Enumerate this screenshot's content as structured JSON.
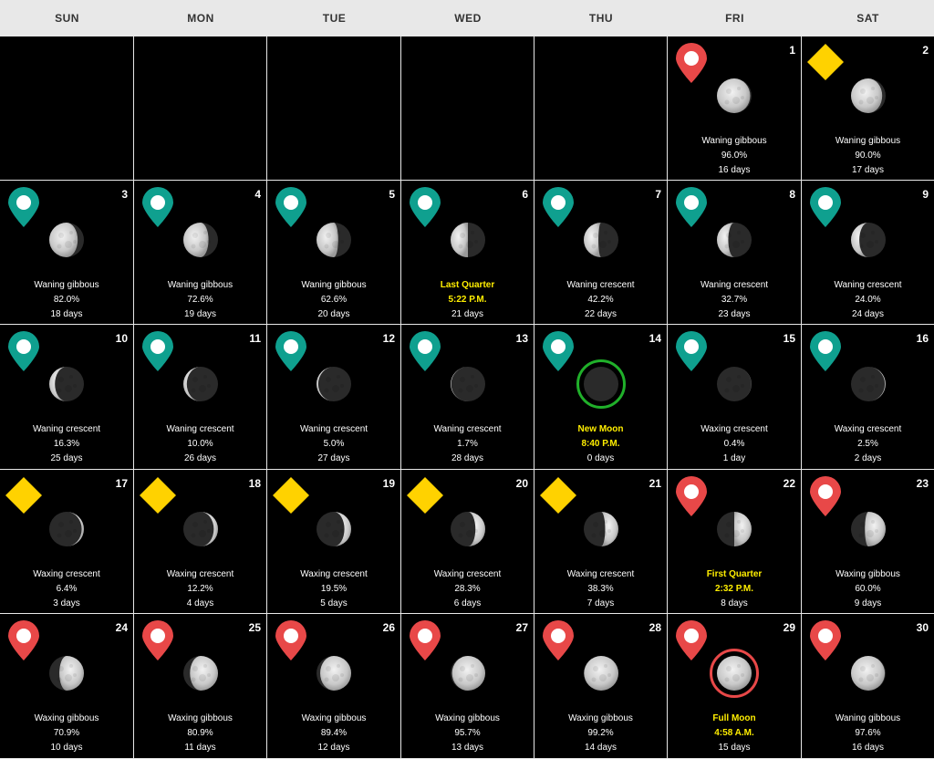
{
  "weekdays": [
    "SUN",
    "MON",
    "TUE",
    "WED",
    "THU",
    "FRI",
    "SAT"
  ],
  "colors": {
    "header_bg": "#e8e8e8",
    "pin_red": "#e84848",
    "pin_teal": "#0fa08f",
    "diamond_yellow": "#ffd200",
    "highlight_text": "#ffee00",
    "ring_green": "#20b02a",
    "ring_red": "#e84848"
  },
  "days": [
    {
      "day": "1",
      "badge": "pin-red",
      "phase": "Waning gibbous",
      "illum": "96.0%",
      "age": "16 days",
      "lit": 0.96,
      "side": "left"
    },
    {
      "day": "2",
      "badge": "diamond-yellow",
      "phase": "Waning gibbous",
      "illum": "90.0%",
      "age": "17 days",
      "lit": 0.9,
      "side": "left"
    },
    {
      "day": "3",
      "badge": "pin-teal",
      "phase": "Waning gibbous",
      "illum": "82.0%",
      "age": "18 days",
      "lit": 0.82,
      "side": "left"
    },
    {
      "day": "4",
      "badge": "pin-teal",
      "phase": "Waning gibbous",
      "illum": "72.6%",
      "age": "19 days",
      "lit": 0.726,
      "side": "left"
    },
    {
      "day": "5",
      "badge": "pin-teal",
      "phase": "Waning gibbous",
      "illum": "62.6%",
      "age": "20 days",
      "lit": 0.626,
      "side": "left"
    },
    {
      "day": "6",
      "badge": "pin-teal",
      "phase": "Last Quarter",
      "illum": "5:22 P.M.",
      "age": "21 days",
      "highlight": true,
      "lit": 0.5,
      "side": "left"
    },
    {
      "day": "7",
      "badge": "pin-teal",
      "phase": "Waning crescent",
      "illum": "42.2%",
      "age": "22 days",
      "lit": 0.422,
      "side": "left"
    },
    {
      "day": "8",
      "badge": "pin-teal",
      "phase": "Waning crescent",
      "illum": "32.7%",
      "age": "23 days",
      "lit": 0.327,
      "side": "left"
    },
    {
      "day": "9",
      "badge": "pin-teal",
      "phase": "Waning crescent",
      "illum": "24.0%",
      "age": "24 days",
      "lit": 0.24,
      "side": "left"
    },
    {
      "day": "10",
      "badge": "pin-teal",
      "phase": "Waning crescent",
      "illum": "16.3%",
      "age": "25 days",
      "lit": 0.163,
      "side": "left"
    },
    {
      "day": "11",
      "badge": "pin-teal",
      "phase": "Waning crescent",
      "illum": "10.0%",
      "age": "26 days",
      "lit": 0.1,
      "side": "left"
    },
    {
      "day": "12",
      "badge": "pin-teal",
      "phase": "Waning crescent",
      "illum": "5.0%",
      "age": "27 days",
      "lit": 0.05,
      "side": "left"
    },
    {
      "day": "13",
      "badge": "pin-teal",
      "phase": "Waning crescent",
      "illum": "1.7%",
      "age": "28 days",
      "lit": 0.017,
      "side": "left"
    },
    {
      "day": "14",
      "badge": "pin-teal",
      "phase": "New Moon",
      "illum": "8:40 P.M.",
      "age": "0 days",
      "highlight": true,
      "ring": "green",
      "lit": 0.0,
      "side": "right"
    },
    {
      "day": "15",
      "badge": "pin-teal",
      "phase": "Waxing crescent",
      "illum": "0.4%",
      "age": "1 day",
      "lit": 0.004,
      "side": "right"
    },
    {
      "day": "16",
      "badge": "pin-teal",
      "phase": "Waxing crescent",
      "illum": "2.5%",
      "age": "2 days",
      "lit": 0.025,
      "side": "right"
    },
    {
      "day": "17",
      "badge": "diamond-yellow",
      "phase": "Waxing crescent",
      "illum": "6.4%",
      "age": "3 days",
      "lit": 0.064,
      "side": "right"
    },
    {
      "day": "18",
      "badge": "diamond-yellow",
      "phase": "Waxing crescent",
      "illum": "12.2%",
      "age": "4 days",
      "lit": 0.122,
      "side": "right"
    },
    {
      "day": "19",
      "badge": "diamond-yellow",
      "phase": "Waxing crescent",
      "illum": "19.5%",
      "age": "5 days",
      "lit": 0.195,
      "side": "right"
    },
    {
      "day": "20",
      "badge": "diamond-yellow",
      "phase": "Waxing crescent",
      "illum": "28.3%",
      "age": "6 days",
      "lit": 0.283,
      "side": "right"
    },
    {
      "day": "21",
      "badge": "diamond-yellow",
      "phase": "Waxing crescent",
      "illum": "38.3%",
      "age": "7 days",
      "lit": 0.383,
      "side": "right"
    },
    {
      "day": "22",
      "badge": "pin-red",
      "phase": "First Quarter",
      "illum": "2:32 P.M.",
      "age": "8 days",
      "highlight": true,
      "lit": 0.5,
      "side": "right"
    },
    {
      "day": "23",
      "badge": "pin-red",
      "phase": "Waxing gibbous",
      "illum": "60.0%",
      "age": "9 days",
      "lit": 0.6,
      "side": "right"
    },
    {
      "day": "24",
      "badge": "pin-red",
      "phase": "Waxing gibbous",
      "illum": "70.9%",
      "age": "10 days",
      "lit": 0.709,
      "side": "right"
    },
    {
      "day": "25",
      "badge": "pin-red",
      "phase": "Waxing gibbous",
      "illum": "80.9%",
      "age": "11 days",
      "lit": 0.809,
      "side": "right"
    },
    {
      "day": "26",
      "badge": "pin-red",
      "phase": "Waxing gibbous",
      "illum": "89.4%",
      "age": "12 days",
      "lit": 0.894,
      "side": "right"
    },
    {
      "day": "27",
      "badge": "pin-red",
      "phase": "Waxing gibbous",
      "illum": "95.7%",
      "age": "13 days",
      "lit": 0.957,
      "side": "right"
    },
    {
      "day": "28",
      "badge": "pin-red",
      "phase": "Waxing gibbous",
      "illum": "99.2%",
      "age": "14 days",
      "lit": 0.992,
      "side": "right"
    },
    {
      "day": "29",
      "badge": "pin-red",
      "phase": "Full Moon",
      "illum": "4:58 A.M.",
      "age": "15 days",
      "highlight": true,
      "ring": "red",
      "lit": 1.0,
      "side": "right"
    },
    {
      "day": "30",
      "badge": "pin-red",
      "phase": "Waning gibbous",
      "illum": "97.6%",
      "age": "16 days",
      "lit": 0.976,
      "side": "left"
    }
  ]
}
